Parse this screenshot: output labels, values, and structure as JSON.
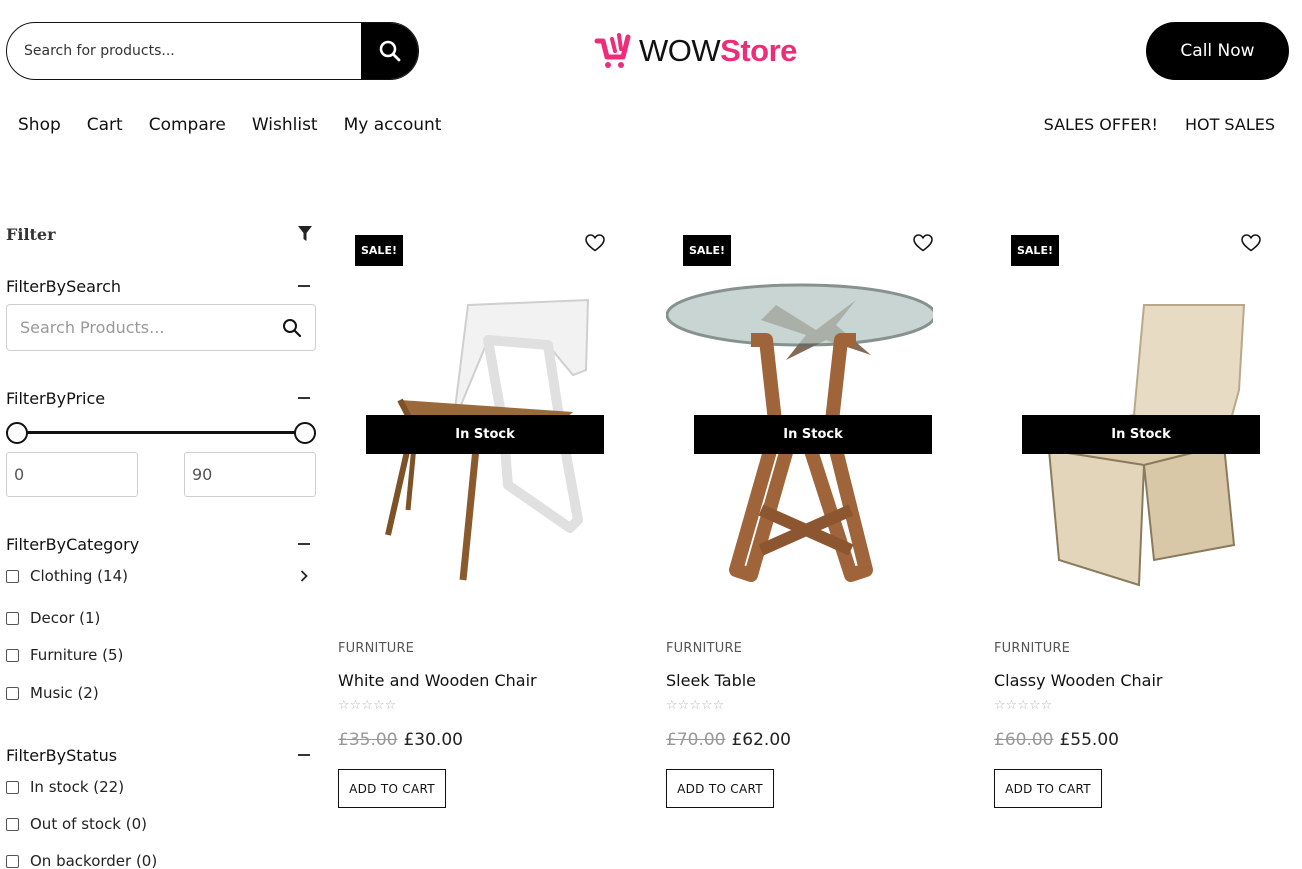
{
  "header": {
    "search_placeholder": "Search for products...",
    "logo_wow": "WOW",
    "logo_store": "Store",
    "call_label": "Call Now"
  },
  "nav": {
    "left": [
      "Shop",
      "Cart",
      "Compare",
      "Wishlist",
      "My account"
    ],
    "right": [
      "SALES OFFER!",
      "HOT SALES"
    ]
  },
  "sidebar": {
    "title": "Filter",
    "search": {
      "title": "FilterBySearch",
      "placeholder": "Search Products..."
    },
    "price": {
      "title": "FilterByPrice",
      "min": "0",
      "max": "90"
    },
    "category": {
      "title": "FilterByCategory",
      "items": [
        {
          "label": "Clothing (14)"
        },
        {
          "label": "Decor (1)"
        },
        {
          "label": "Furniture (5)"
        },
        {
          "label": "Music (2)"
        }
      ]
    },
    "status": {
      "title": "FilterByStatus",
      "items": [
        {
          "label": "In stock (22)"
        },
        {
          "label": "Out of stock (0)"
        },
        {
          "label": "On backorder (0)"
        }
      ]
    }
  },
  "products": [
    {
      "badge": "SALE!",
      "stock": "In Stock",
      "category": "FURNITURE",
      "name": "White and Wooden Chair",
      "old_price": "£35.00",
      "price": "£30.00",
      "cta": "ADD TO CART"
    },
    {
      "badge": "SALE!",
      "stock": "In Stock",
      "category": "FURNITURE",
      "name": "Sleek Table",
      "old_price": "£70.00",
      "price": "£62.00",
      "cta": "ADD TO CART"
    },
    {
      "badge": "SALE!",
      "stock": "In Stock",
      "category": "FURNITURE",
      "name": "Classy Wooden Chair",
      "old_price": "£60.00",
      "price": "£55.00",
      "cta": "ADD TO CART"
    }
  ],
  "colors": {
    "accent": "#ee2d7a",
    "primary": "#000000"
  }
}
